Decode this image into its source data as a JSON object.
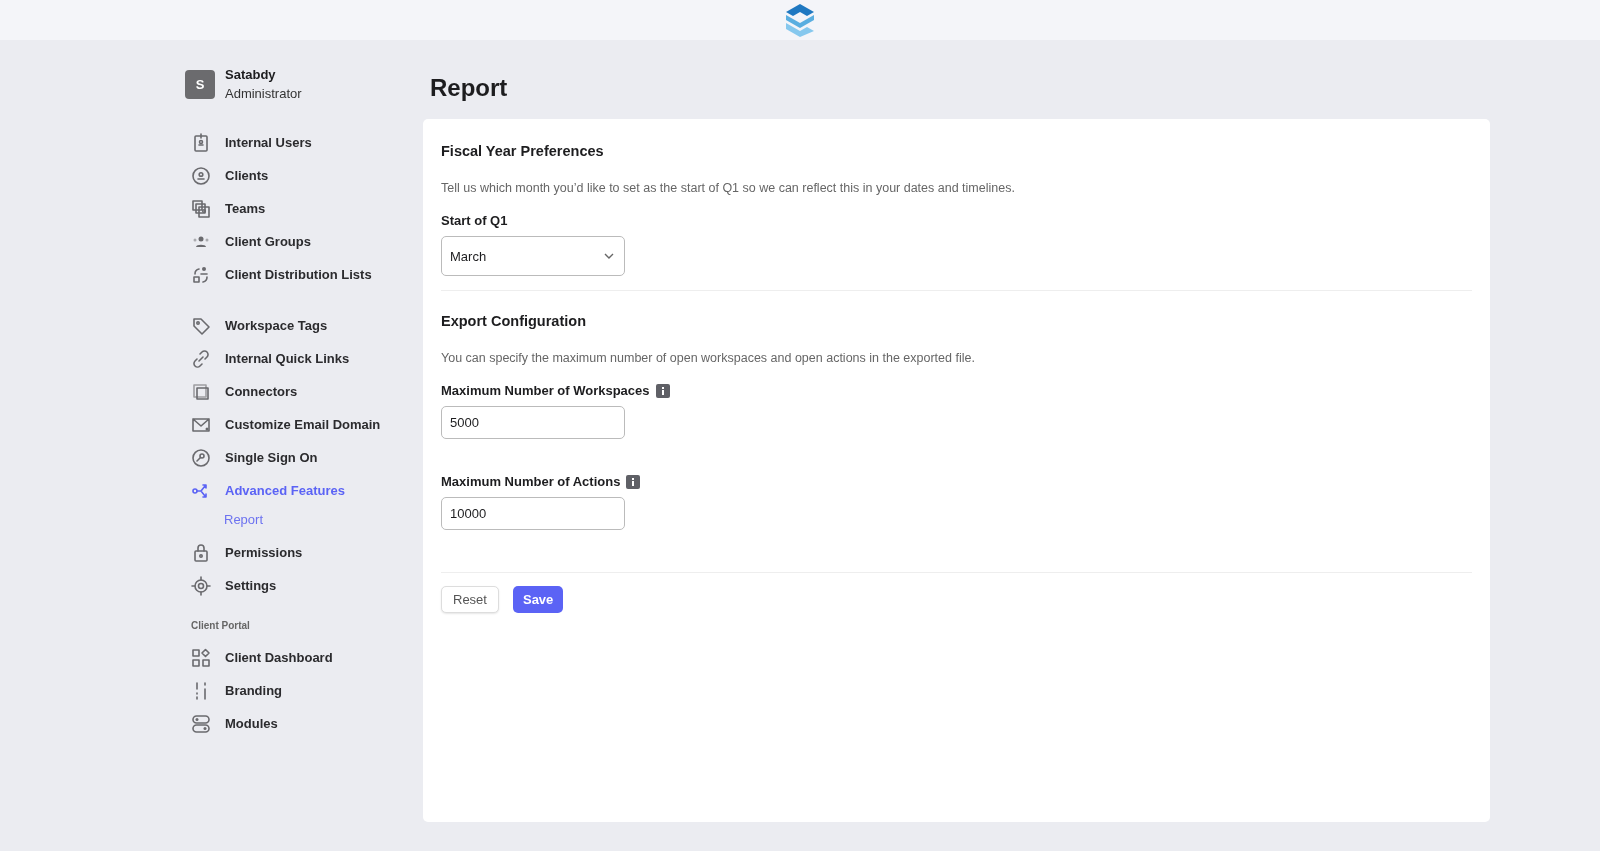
{
  "user": {
    "initial": "S",
    "name": "Satabdy",
    "role": "Administrator"
  },
  "sidebar": {
    "groups": [
      {
        "items": [
          {
            "label": "Internal Users",
            "selected": false
          },
          {
            "label": "Clients",
            "selected": false
          },
          {
            "label": "Teams",
            "selected": false
          },
          {
            "label": "Client Groups",
            "selected": false
          },
          {
            "label": "Client Distribution Lists",
            "selected": false
          }
        ]
      },
      {
        "items": [
          {
            "label": "Workspace Tags",
            "selected": false
          },
          {
            "label": "Internal Quick Links",
            "selected": false
          },
          {
            "label": "Connectors",
            "selected": false
          },
          {
            "label": "Customize Email Domain",
            "selected": false
          },
          {
            "label": "Single Sign On",
            "selected": false
          },
          {
            "label": "Advanced Features",
            "selected": true,
            "children": [
              {
                "label": "Report",
                "selected": true
              }
            ]
          },
          {
            "label": "Permissions",
            "selected": false
          },
          {
            "label": "Settings",
            "selected": false
          }
        ]
      },
      {
        "heading": "Client Portal",
        "items": [
          {
            "label": "Client Dashboard",
            "selected": false
          },
          {
            "label": "Branding",
            "selected": false
          },
          {
            "label": "Modules",
            "selected": false
          }
        ]
      }
    ]
  },
  "page": {
    "title": "Report"
  },
  "sections": [
    {
      "title": "Fiscal Year Preferences",
      "description": "Tell us which month you’d like to set as the start of Q1 so we can reflect this in your dates and timelines.",
      "fields": [
        {
          "kind": "select",
          "label": "Start of Q1",
          "value": "March",
          "info": false
        }
      ]
    },
    {
      "title": "Export Configuration",
      "description": "You can specify the maximum number of open workspaces and open actions in the exported file.",
      "fields": [
        {
          "kind": "input",
          "label": "Maximum Number of Workspaces",
          "value": "5000",
          "info": true
        },
        {
          "kind": "input",
          "label": "Maximum Number of Actions",
          "value": "10000",
          "info": true
        }
      ]
    }
  ],
  "buttons": [
    {
      "label": "Reset",
      "kind": "secondary"
    },
    {
      "label": "Save",
      "kind": "primary"
    }
  ]
}
